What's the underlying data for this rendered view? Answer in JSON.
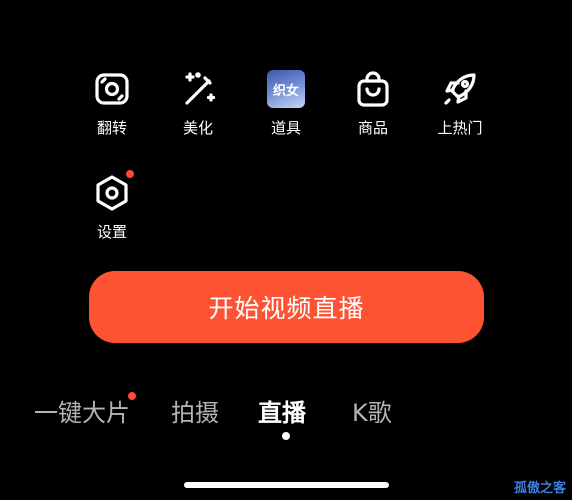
{
  "tools": [
    {
      "id": "flip",
      "label": "翻转",
      "icon": "camera-flip-icon"
    },
    {
      "id": "beautify",
      "label": "美化",
      "icon": "magic-wand-icon"
    },
    {
      "id": "props",
      "label": "道具",
      "icon": "props-thumbnail",
      "thumb_text": "织女"
    },
    {
      "id": "products",
      "label": "商品",
      "icon": "shopping-bag-icon"
    },
    {
      "id": "trending",
      "label": "上热门",
      "icon": "rocket-icon"
    },
    {
      "id": "settings",
      "label": "设置",
      "icon": "settings-hexagon-icon",
      "badge": true
    }
  ],
  "start_button": {
    "label": "开始视频直播"
  },
  "modes": [
    {
      "label": "一键大片",
      "badge": true
    },
    {
      "label": "拍摄"
    },
    {
      "label": "直播",
      "active": true
    },
    {
      "label": "K歌"
    }
  ],
  "watermark": "孤傲之客",
  "colors": {
    "background": "#000000",
    "primary": "#fe5333",
    "badge": "#ff4a3a",
    "inactive_text": "#b3b3b3",
    "watermark": "#3d7fe0"
  }
}
